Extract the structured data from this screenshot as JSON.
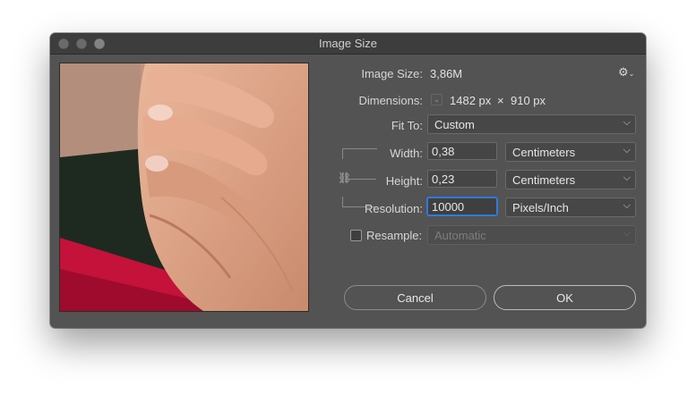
{
  "window": {
    "title": "Image Size"
  },
  "info": {
    "image_size_label": "Image Size:",
    "image_size_value": "3,86M",
    "dimensions_label": "Dimensions:",
    "dimensions_width": "1482 px",
    "dimensions_times": "×",
    "dimensions_height": "910 px"
  },
  "fit_to": {
    "label": "Fit To:",
    "value": "Custom"
  },
  "width": {
    "label": "Width:",
    "value": "0,38",
    "unit": "Centimeters"
  },
  "height": {
    "label": "Height:",
    "value": "0,23",
    "unit": "Centimeters"
  },
  "resolution": {
    "label": "Resolution:",
    "value": "10000",
    "unit": "Pixels/Inch"
  },
  "resample": {
    "label": "Resample:",
    "checked": false,
    "value": "Automatic"
  },
  "buttons": {
    "cancel": "Cancel",
    "ok": "OK"
  },
  "icons": {
    "gear": "gear-icon",
    "chevron": "chevron-down-icon",
    "link": "link-icon"
  },
  "colors": {
    "dialog_bg": "#535353",
    "focus_ring": "#2f7bd9"
  }
}
